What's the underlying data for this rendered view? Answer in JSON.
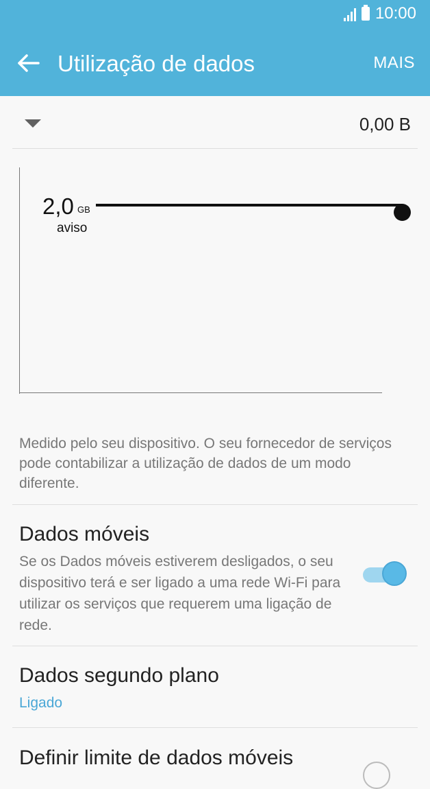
{
  "status_bar": {
    "time": "10:00",
    "signal_icon": "signal-icon",
    "battery_icon": "battery-icon"
  },
  "app_bar": {
    "title": "Utilização de dados",
    "more_label": "MAIS",
    "back_icon": "back-arrow-icon"
  },
  "cycle": {
    "usage": "0,00 B"
  },
  "chart_data": {
    "type": "line",
    "warning": {
      "value": "2,0",
      "unit": "GB",
      "label": "aviso"
    },
    "series": []
  },
  "note": "Medido pelo seu dispositivo. O seu fornecedor de serviços pode contabilizar a utilização de dados de um modo diferente.",
  "mobile_data": {
    "title": "Dados móveis",
    "description": "Se os Dados móveis estiverem desligados, o seu dispositivo terá e ser ligado a uma rede Wi-Fi para utilizar os serviços que requerem uma ligação de rede.",
    "enabled": true,
    "accent_color": "#59b9e6"
  },
  "background_data": {
    "title": "Dados segundo plano",
    "status": "Ligado"
  },
  "data_limit": {
    "title": "Definir limite de dados móveis",
    "enabled": false
  },
  "colors": {
    "app_bar": "#51b3da",
    "accent": "#4aa7d6"
  }
}
